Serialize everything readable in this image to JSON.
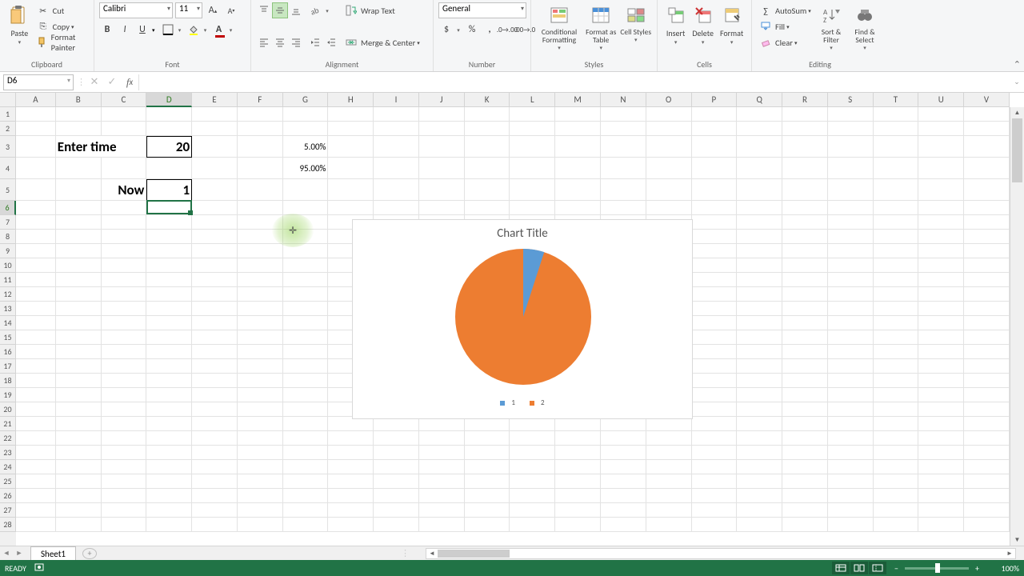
{
  "ribbon": {
    "clipboard": {
      "paste": "Paste",
      "cut": "Cut",
      "copy": "Copy",
      "format_painter": "Format Painter",
      "label": "Clipboard"
    },
    "font": {
      "name": "Calibri",
      "size": "11",
      "label": "Font"
    },
    "alignment": {
      "wrap": "Wrap Text",
      "merge": "Merge & Center",
      "label": "Alignment"
    },
    "number": {
      "format": "General",
      "label": "Number"
    },
    "styles": {
      "cond": "Conditional Formatting",
      "table": "Format as Table",
      "cell": "Cell Styles",
      "label": "Styles"
    },
    "cells": {
      "insert": "Insert",
      "delete": "Delete",
      "format": "Format",
      "label": "Cells"
    },
    "editing": {
      "sum": "AutoSum",
      "fill": "Fill",
      "clear": "Clear",
      "sort": "Sort & Filter",
      "find": "Find & Select",
      "label": "Editing"
    }
  },
  "formula_bar": {
    "cell_ref": "D6",
    "formula": ""
  },
  "columns": [
    "A",
    "B",
    "C",
    "D",
    "E",
    "F",
    "G",
    "H",
    "I",
    "J",
    "K",
    "L",
    "M",
    "N",
    "O",
    "P",
    "Q",
    "R",
    "S",
    "T",
    "U",
    "V"
  ],
  "rows": [
    "1",
    "2",
    "3",
    "4",
    "5",
    "6",
    "7",
    "8",
    "9",
    "10",
    "11",
    "12",
    "13",
    "14",
    "15",
    "16",
    "17",
    "18",
    "19",
    "20",
    "21",
    "22",
    "23",
    "24",
    "25",
    "26",
    "27",
    "28"
  ],
  "selected_col": "D",
  "selected_row": "6",
  "cell_values": {
    "BC3": "Enter time",
    "D3": "20",
    "G3": "5.00%",
    "G4": "95.00%",
    "C5": "Now",
    "D5": "1"
  },
  "chart_data": {
    "type": "pie",
    "title": "Chart Title",
    "series": [
      {
        "name": "1",
        "value": 5.0,
        "color": "#5b9bd5"
      },
      {
        "name": "2",
        "value": 95.0,
        "color": "#ed7d31"
      }
    ]
  },
  "sheet_tab": "Sheet1",
  "status": {
    "ready": "READY",
    "zoom": "100%",
    "zoom_minus": "−",
    "zoom_plus": "+"
  }
}
